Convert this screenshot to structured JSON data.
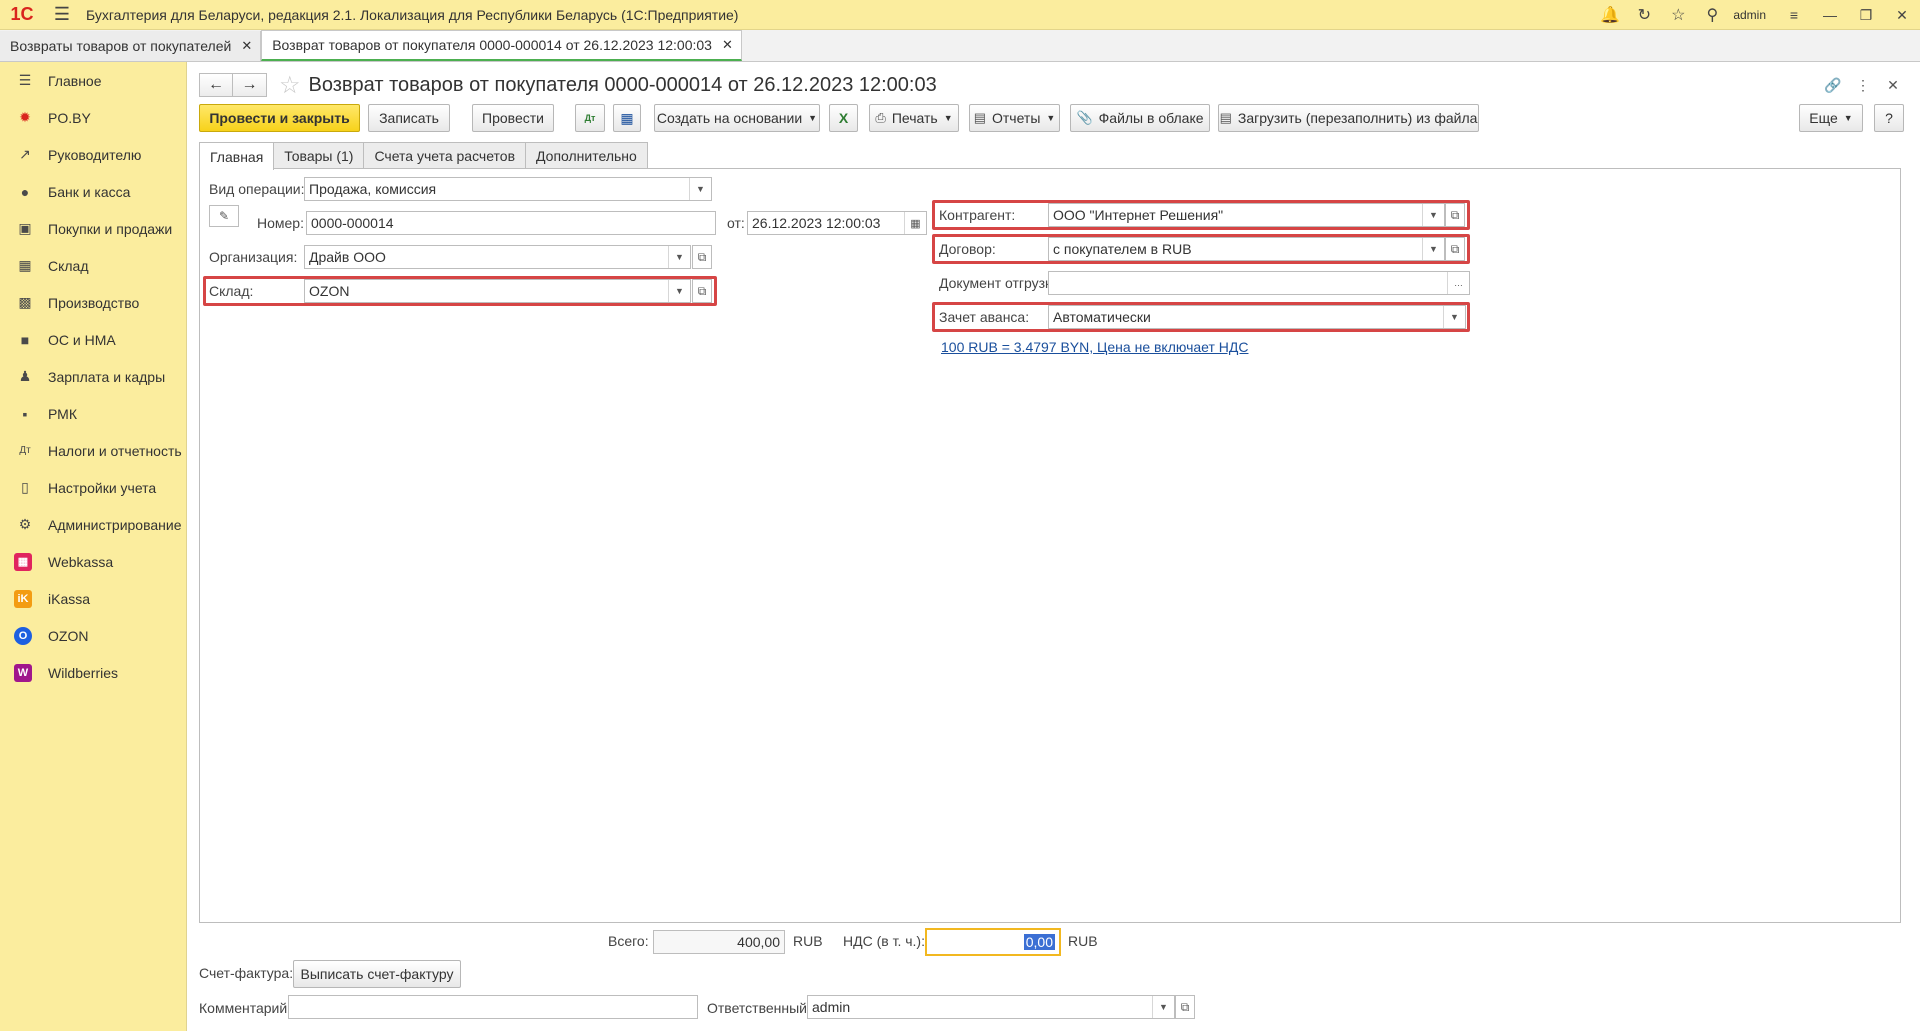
{
  "app": {
    "logo": "1С",
    "title": "Бухгалтерия для Беларуси, редакция 2.1. Локализация для Республики Беларусь   (1С:Предприятие)",
    "user": "admin"
  },
  "tabs": [
    {
      "label": "Возвраты товаров от покупателей"
    },
    {
      "label": "Возврат товаров от покупателя 0000-000014 от 26.12.2023 12:00:03"
    }
  ],
  "sidebar": {
    "items": [
      {
        "label": "Главное",
        "icon": "menu-icon"
      },
      {
        "label": "PO.BY",
        "icon": "po-by-icon"
      },
      {
        "label": "Руководителю",
        "icon": "trend-icon"
      },
      {
        "label": "Банк и касса",
        "icon": "coin-icon"
      },
      {
        "label": "Покупки и продажи",
        "icon": "cart-icon"
      },
      {
        "label": "Склад",
        "icon": "warehouse-icon"
      },
      {
        "label": "Производство",
        "icon": "factory-icon"
      },
      {
        "label": "ОС и НМА",
        "icon": "truck-icon"
      },
      {
        "label": "Зарплата и кадры",
        "icon": "person-icon"
      },
      {
        "label": "РМК",
        "icon": "cash-register-icon"
      },
      {
        "label": "Налоги и отчетность",
        "icon": "dt-kt-icon"
      },
      {
        "label": "Настройки учета",
        "icon": "book-icon"
      },
      {
        "label": "Администрирование",
        "icon": "gear-icon"
      },
      {
        "label": "Webkassa",
        "icon": "webkassa-icon"
      },
      {
        "label": "iKassa",
        "icon": "ikassa-icon"
      },
      {
        "label": "OZON",
        "icon": "ozon-icon"
      },
      {
        "label": "Wildberries",
        "icon": "wildberries-icon"
      }
    ]
  },
  "form": {
    "title": "Возврат товаров от покупателя 0000-000014 от 26.12.2023 12:00:03",
    "toolbar": {
      "post_close": "Провести и закрыть",
      "save": "Записать",
      "post": "Провести",
      "create_based": "Создать на основании",
      "print": "Печать",
      "reports": "Отчеты",
      "files_cloud": "Файлы в облаке",
      "load_file": "Загрузить (перезаполнить) из файла",
      "more": "Еще",
      "help": "?"
    },
    "tabs": [
      {
        "label": "Главная"
      },
      {
        "label": "Товары (1)"
      },
      {
        "label": "Счета учета расчетов"
      },
      {
        "label": "Дополнительно"
      }
    ],
    "fields": {
      "operation_label": "Вид операции:",
      "operation_value": "Продажа, комиссия",
      "number_label": "Номер:",
      "number_value": "0000-000014",
      "date_label": "от:",
      "date_value": "26.12.2023 12:00:03",
      "org_label": "Организация:",
      "org_value": "Драйв ООО",
      "warehouse_label": "Склад:",
      "warehouse_value": "OZON",
      "counterparty_label": "Контрагент:",
      "counterparty_value": "ООО \"Интернет Решения\"",
      "contract_label": "Договор:",
      "contract_value": "с покупателем в RUB",
      "shipment_doc_label": "Документ отгрузки:",
      "shipment_doc_value": "",
      "advance_label": "Зачет аванса:",
      "advance_value": "Автоматически",
      "rate_link": "100 RUB = 3.4797 BYN, Цена не включает НДС"
    },
    "totals": {
      "total_label": "Всего:",
      "total_value": "400,00",
      "currency": "RUB",
      "vat_label": "НДС (в т. ч.):",
      "vat_value": "0,00",
      "vat_currency": "RUB"
    },
    "invoice": {
      "label": "Счет-фактура:",
      "button": "Выписать счет-фактуру"
    },
    "comment": {
      "label": "Комментарий:",
      "value": ""
    },
    "responsible": {
      "label": "Ответственный:",
      "value": "admin"
    }
  },
  "colors": {
    "sidebar_bg": "#fbed9e",
    "primary_button": "#f7d21a",
    "highlight_border": "#d64545",
    "link": "#1a4f9c"
  }
}
